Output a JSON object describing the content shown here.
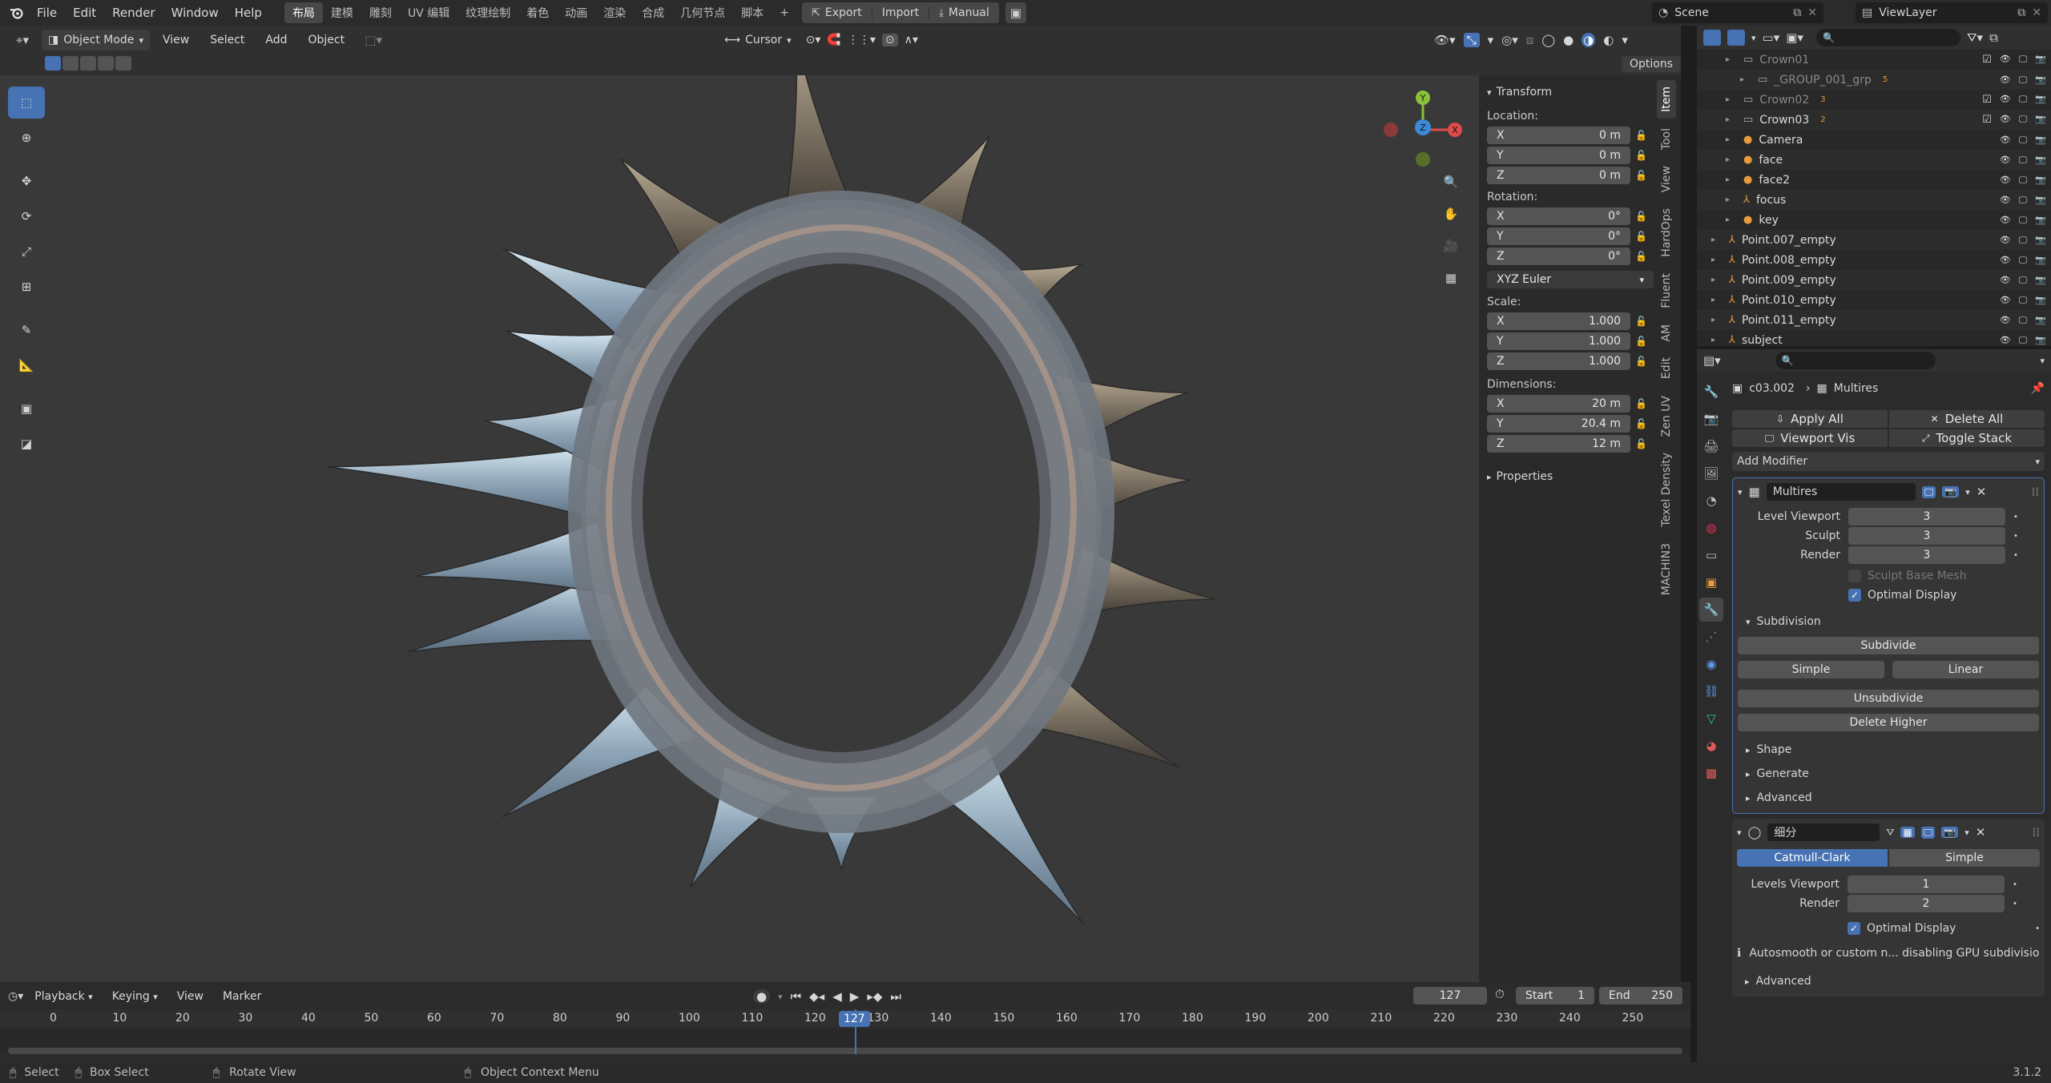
{
  "topbar": {
    "menus": [
      "File",
      "Edit",
      "Render",
      "Window",
      "Help"
    ],
    "workspaces": [
      "布局",
      "建模",
      "雕刻",
      "UV 编辑",
      "纹理绘制",
      "着色",
      "动画",
      "渲染",
      "合成",
      "几何节点",
      "脚本"
    ],
    "add_workspace": "+",
    "export_label": "Export",
    "import_label": "Import",
    "manual_label": "Manual",
    "scene_label": "Scene",
    "viewlayer_label": "ViewLayer"
  },
  "viewport_header": {
    "mode": "Object Mode",
    "menus": [
      "View",
      "Select",
      "Add",
      "Object"
    ],
    "pivot_label": "Cursor",
    "options_label": "Options"
  },
  "npanel": {
    "transform_title": "Transform",
    "location_label": "Location:",
    "location": [
      {
        "axis": "X",
        "value": "0 m"
      },
      {
        "axis": "Y",
        "value": "0 m"
      },
      {
        "axis": "Z",
        "value": "0 m"
      }
    ],
    "rotation_label": "Rotation:",
    "rotation": [
      {
        "axis": "X",
        "value": "0°"
      },
      {
        "axis": "Y",
        "value": "0°"
      },
      {
        "axis": "Z",
        "value": "0°"
      }
    ],
    "rotation_mode": "XYZ Euler",
    "scale_label": "Scale:",
    "scale": [
      {
        "axis": "X",
        "value": "1.000"
      },
      {
        "axis": "Y",
        "value": "1.000"
      },
      {
        "axis": "Z",
        "value": "1.000"
      }
    ],
    "dimensions_label": "Dimensions:",
    "dimensions": [
      {
        "axis": "X",
        "value": "20 m"
      },
      {
        "axis": "Y",
        "value": "20.4 m"
      },
      {
        "axis": "Z",
        "value": "12 m"
      }
    ],
    "properties_title": "Properties",
    "tabs": [
      "Item",
      "Tool",
      "View",
      "HardOps",
      "Fluent",
      "AM",
      "Edit",
      "Zen UV",
      "Texel Density",
      "MACHIN3"
    ]
  },
  "outliner": {
    "rows": [
      {
        "name": "Crown01",
        "badge": ""
      },
      {
        "name": "_GROUP_001_grp",
        "badge": "5"
      },
      {
        "name": "Crown02",
        "badge": "3"
      },
      {
        "name": "Crown03",
        "badge": "2"
      },
      {
        "name": "Camera",
        "badge": ""
      },
      {
        "name": "face",
        "badge": ""
      },
      {
        "name": "face2",
        "badge": ""
      },
      {
        "name": "focus",
        "badge": ""
      },
      {
        "name": "key",
        "badge": ""
      },
      {
        "name": "Point.007_empty",
        "badge": ""
      },
      {
        "name": "Point.008_empty",
        "badge": ""
      },
      {
        "name": "Point.009_empty",
        "badge": ""
      },
      {
        "name": "Point.010_empty",
        "badge": ""
      },
      {
        "name": "Point.011_empty",
        "badge": ""
      },
      {
        "name": "subject",
        "badge": ""
      }
    ]
  },
  "properties": {
    "object_name": "c03.002",
    "modifier_context": "Multires",
    "apply_all": "Apply All",
    "delete_all": "Delete All",
    "viewport_vis": "Viewport Vis",
    "toggle_stack": "Toggle Stack",
    "add_modifier": "Add Modifier",
    "multires": {
      "name": "Multires",
      "level_viewport_label": "Level Viewport",
      "level_viewport": "3",
      "sculpt_label": "Sculpt",
      "sculpt": "3",
      "render_label": "Render",
      "render": "3",
      "sculpt_base_mesh": "Sculpt Base Mesh",
      "optimal_display": "Optimal Display",
      "subdivision_title": "Subdivision",
      "subdivide": "Subdivide",
      "simple": "Simple",
      "linear": "Linear",
      "unsubdivide": "Unsubdivide",
      "delete_higher": "Delete Higher",
      "shape": "Shape",
      "generate": "Generate",
      "advanced": "Advanced"
    },
    "subsurf": {
      "name": "细分",
      "catmull": "Catmull-Clark",
      "simple": "Simple",
      "levels_viewport_label": "Levels Viewport",
      "levels_viewport": "1",
      "render_label": "Render",
      "render": "2",
      "optimal_display": "Optimal Display",
      "warning": "Autosmooth or custom n... disabling GPU subdivision",
      "advanced": "Advanced"
    }
  },
  "timeline": {
    "menus": [
      "Playback",
      "Keying",
      "View",
      "Marker"
    ],
    "current_frame": "127",
    "start_label": "Start",
    "start": "1",
    "end_label": "End",
    "end": "250",
    "ticks": [
      "0",
      "10",
      "20",
      "30",
      "40",
      "50",
      "60",
      "70",
      "80",
      "90",
      "100",
      "110",
      "120",
      "130",
      "140",
      "150",
      "160",
      "170",
      "180",
      "190",
      "200",
      "210",
      "220",
      "230",
      "240",
      "250"
    ]
  },
  "statusbar": {
    "select": "Select",
    "box_select": "Box Select",
    "rotate_view": "Rotate View",
    "context_menu": "Object Context Menu",
    "version": "3.1.2"
  },
  "gizmo": {
    "x": "X",
    "y": "Y",
    "z": "Z"
  },
  "colors": {
    "accent": "#4772b3",
    "x_axis": "#e04a4a",
    "y_axis": "#8ac33a",
    "z_axis": "#3c8ad7"
  }
}
